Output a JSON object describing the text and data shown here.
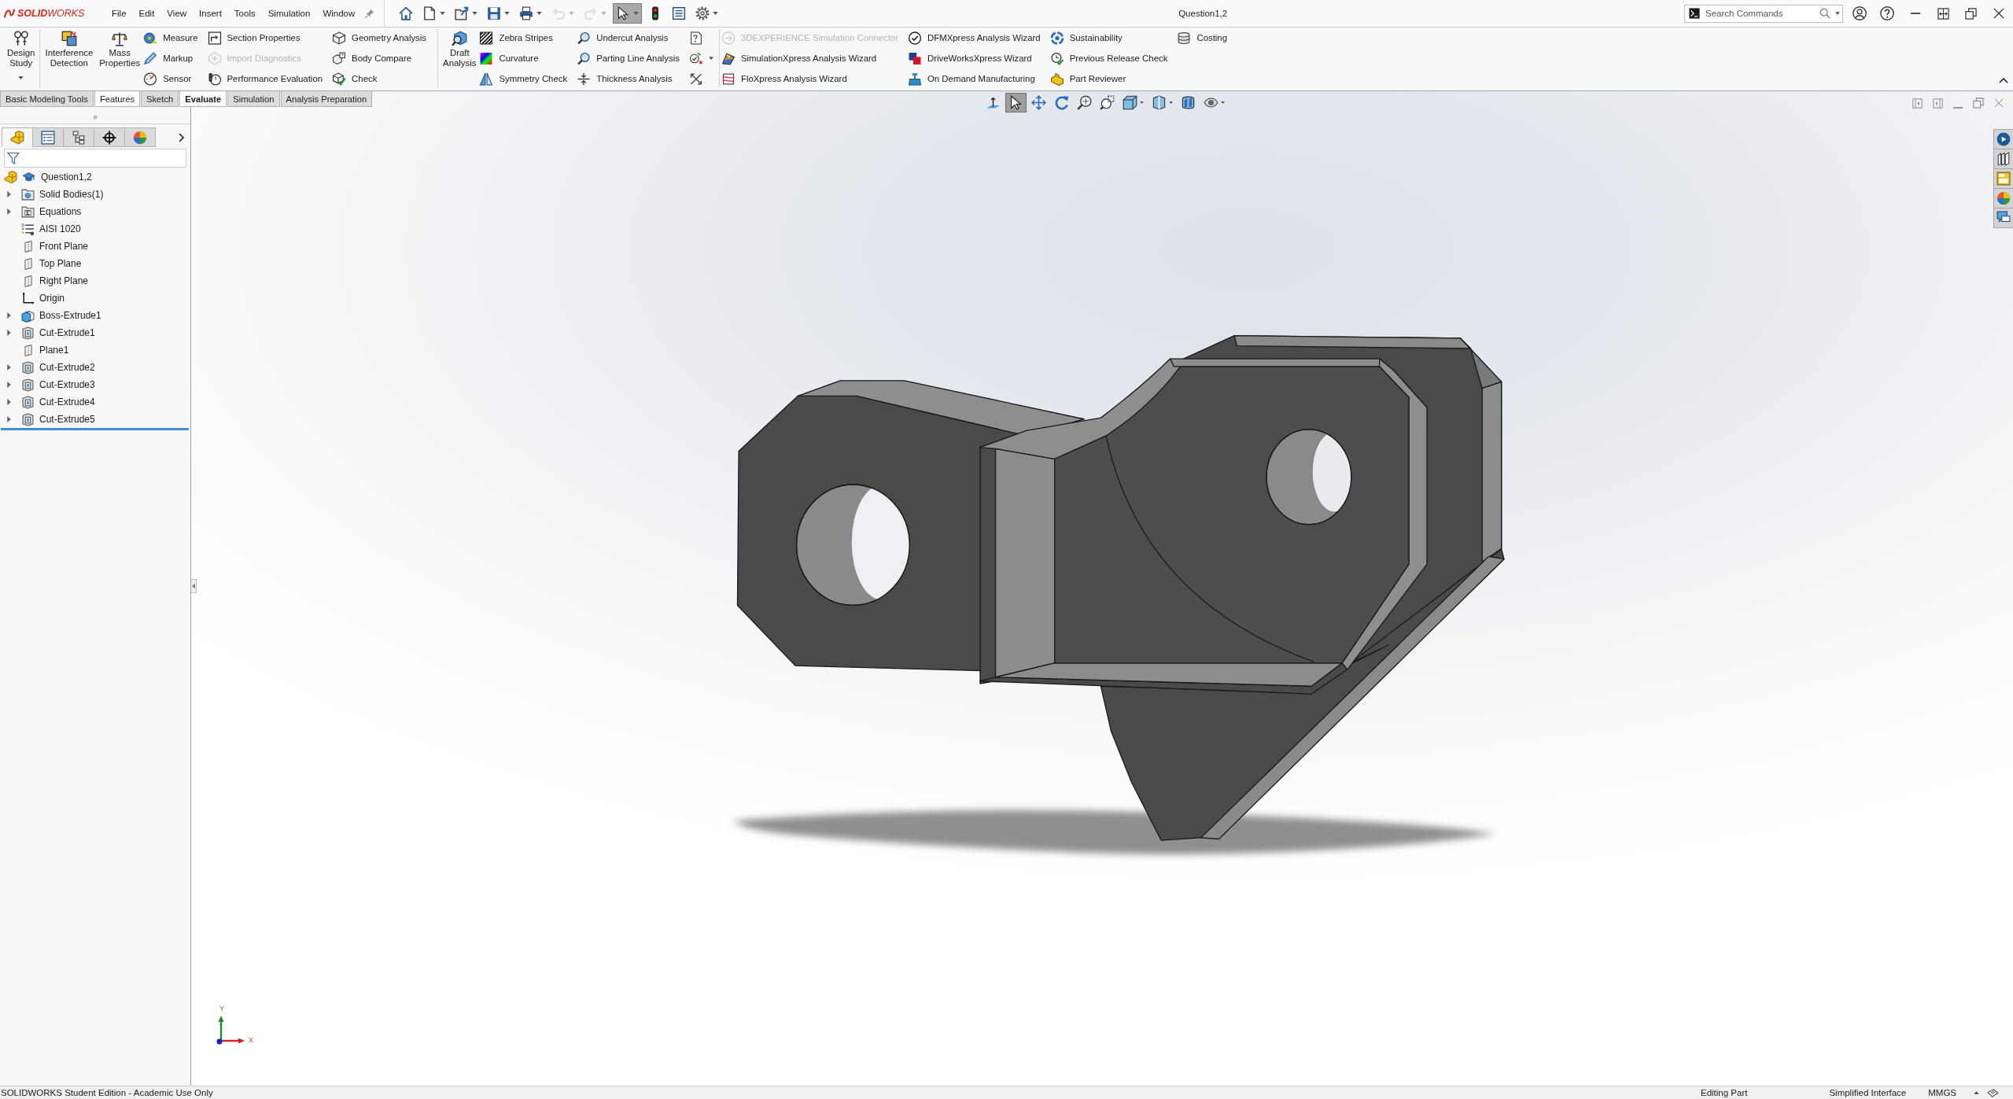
{
  "title_bar": {
    "logo": "**SOLID**WORKS",
    "menus": [
      "File",
      "Edit",
      "View",
      "Insert",
      "Tools",
      "Simulation",
      "Window"
    ],
    "quick_access": [
      {
        "kind": "home",
        "dropdown": false,
        "disabled": false,
        "selected": false
      },
      {
        "kind": "new",
        "dropdown": true,
        "disabled": false,
        "selected": false
      },
      {
        "kind": "open",
        "dropdown": true,
        "disabled": false,
        "selected": false
      },
      {
        "kind": "save",
        "dropdown": true,
        "disabled": false,
        "selected": false
      },
      {
        "kind": "print",
        "dropdown": true,
        "disabled": false,
        "selected": false
      },
      {
        "kind": "undo",
        "dropdown": true,
        "disabled": true,
        "selected": false
      },
      {
        "kind": "redo",
        "dropdown": true,
        "disabled": true,
        "selected": false
      },
      {
        "kind": "select",
        "dropdown": true,
        "disabled": false,
        "selected": true
      },
      {
        "kind": "rebuild",
        "dropdown": false,
        "disabled": false,
        "selected": false
      },
      {
        "kind": "properties",
        "dropdown": false,
        "disabled": false,
        "selected": false
      },
      {
        "kind": "options",
        "dropdown": true,
        "disabled": false,
        "selected": false
      }
    ],
    "document_title": "Question1,2",
    "search": {
      "placeholder": "Search Commands"
    }
  },
  "ribbon": {
    "groups": [
      {
        "columns": [
          {
            "kind": "large",
            "label": "Design Study",
            "dropdown": true
          }
        ]
      },
      {
        "columns": [
          {
            "kind": "large",
            "label": "Interference Detection",
            "dropdown": false
          },
          {
            "kind": "large",
            "label": "Mass Properties",
            "dropdown": false
          },
          {
            "kind": "stack",
            "items": [
              {
                "label": "Measure",
                "disabled": false
              },
              {
                "label": "Markup",
                "disabled": false
              },
              {
                "label": "Sensor",
                "disabled": false
              }
            ]
          },
          {
            "kind": "stack",
            "items": [
              {
                "label": "Section Properties",
                "disabled": false
              },
              {
                "label": "Import Diagnostics",
                "disabled": true
              },
              {
                "label": "Performance Evaluation",
                "disabled": false
              }
            ]
          },
          {
            "kind": "stack",
            "items": [
              {
                "label": "Geometry Analysis",
                "disabled": false
              },
              {
                "label": "Body Compare",
                "disabled": false
              },
              {
                "label": "Check",
                "disabled": false
              }
            ]
          }
        ]
      },
      {
        "columns": [
          {
            "kind": "large",
            "label": "Draft Analysis",
            "dropdown": false
          },
          {
            "kind": "stack",
            "items": [
              {
                "label": "Zebra Stripes",
                "disabled": false
              },
              {
                "label": "Curvature",
                "disabled": false
              },
              {
                "label": "Symmetry Check",
                "disabled": false
              }
            ]
          },
          {
            "kind": "stack",
            "items": [
              {
                "label": "Undercut Analysis",
                "disabled": false
              },
              {
                "label": "Parting Line Analysis",
                "disabled": false
              },
              {
                "label": "Thickness Analysis",
                "disabled": false
              }
            ]
          },
          {
            "kind": "icons",
            "items": [
              {
                "dropdown": false
              },
              {
                "dropdown": true
              },
              {
                "dropdown": false
              }
            ]
          }
        ]
      },
      {
        "columns": [
          {
            "kind": "stack",
            "items": [
              {
                "label": "3DEXPERIENCE Simulation Connector",
                "disabled": true
              },
              {
                "label": "SimulationXpress Analysis Wizard",
                "disabled": false
              },
              {
                "label": "FloXpress Analysis Wizard",
                "disabled": false
              }
            ]
          },
          {
            "kind": "stack",
            "items": [
              {
                "label": "DFMXpress Analysis Wizard",
                "disabled": false
              },
              {
                "label": "DriveWorksXpress Wizard",
                "disabled": false
              },
              {
                "label": "On Demand Manufacturing",
                "disabled": false
              }
            ]
          },
          {
            "kind": "stack",
            "items": [
              {
                "label": "Sustainability",
                "disabled": false
              },
              {
                "label": "Previous Release Check",
                "disabled": false
              },
              {
                "label": "Part Reviewer",
                "disabled": false
              }
            ]
          },
          {
            "kind": "stack",
            "items": [
              {
                "label": "Costing",
                "disabled": false
              }
            ]
          }
        ]
      }
    ]
  },
  "command_tabs": [
    {
      "label": "Basic Modeling Tools",
      "selected": false,
      "highlighted": false
    },
    {
      "label": "Features",
      "selected": false,
      "highlighted": true
    },
    {
      "label": "Sketch",
      "selected": false,
      "highlighted": false
    },
    {
      "label": "Evaluate",
      "selected": true,
      "highlighted": false
    },
    {
      "label": "Simulation",
      "selected": false,
      "highlighted": false
    },
    {
      "label": "Analysis Preparation",
      "selected": false,
      "highlighted": false
    }
  ],
  "feature_manager": {
    "panel_tabs": [
      {
        "selected": true
      },
      {
        "selected": false
      },
      {
        "selected": false
      },
      {
        "selected": false
      },
      {
        "selected": false
      }
    ],
    "tree": {
      "label": "Question1,2",
      "kind": "part",
      "children": [
        {
          "label": "Solid Bodies(1)",
          "kind": "bodies",
          "expandable": true
        },
        {
          "label": "Equations",
          "kind": "equations",
          "expandable": true
        },
        {
          "label": "AISI 1020",
          "kind": "material",
          "expandable": false
        },
        {
          "label": "Front Plane",
          "kind": "plane",
          "expandable": false
        },
        {
          "label": "Top Plane",
          "kind": "plane",
          "expandable": false
        },
        {
          "label": "Right Plane",
          "kind": "plane",
          "expandable": false
        },
        {
          "label": "Origin",
          "kind": "origin",
          "expandable": false
        },
        {
          "label": "Boss-Extrude1",
          "kind": "boss",
          "expandable": true
        },
        {
          "label": "Cut-Extrude1",
          "kind": "cut",
          "expandable": true
        },
        {
          "label": "Plane1",
          "kind": "plane",
          "expandable": false
        },
        {
          "label": "Cut-Extrude2",
          "kind": "cut",
          "expandable": true
        },
        {
          "label": "Cut-Extrude3",
          "kind": "cut",
          "expandable": true
        },
        {
          "label": "Cut-Extrude4",
          "kind": "cut",
          "expandable": true
        },
        {
          "label": "Cut-Extrude5",
          "kind": "cut",
          "expandable": true
        }
      ]
    }
  },
  "viewport": {
    "heads_up_toolbar": [
      {
        "kind": "normal_to",
        "dropdown": false,
        "selected": false
      },
      {
        "kind": "select",
        "dropdown": false,
        "selected": true
      },
      {
        "kind": "pan",
        "dropdown": false,
        "selected": false
      },
      {
        "kind": "rotate",
        "dropdown": false,
        "selected": false
      },
      {
        "kind": "zoom_fit",
        "dropdown": false,
        "selected": false
      },
      {
        "kind": "zoom_area",
        "dropdown": false,
        "selected": false
      },
      {
        "kind": "view_orientation",
        "dropdown": true,
        "selected": false
      },
      {
        "kind": "display_style",
        "dropdown": true,
        "selected": false
      },
      {
        "kind": "section_view",
        "dropdown": false,
        "selected": false
      },
      {
        "kind": "hide_show",
        "dropdown": true,
        "selected": false
      }
    ],
    "triad": {
      "x_label": "X",
      "y_label": "Y"
    }
  },
  "status_bar": {
    "edition": "SOLIDWORKS Student Edition - Academic Use Only",
    "mode": "Editing Part",
    "interface": "Simplified Interface",
    "units": "MMGS"
  }
}
